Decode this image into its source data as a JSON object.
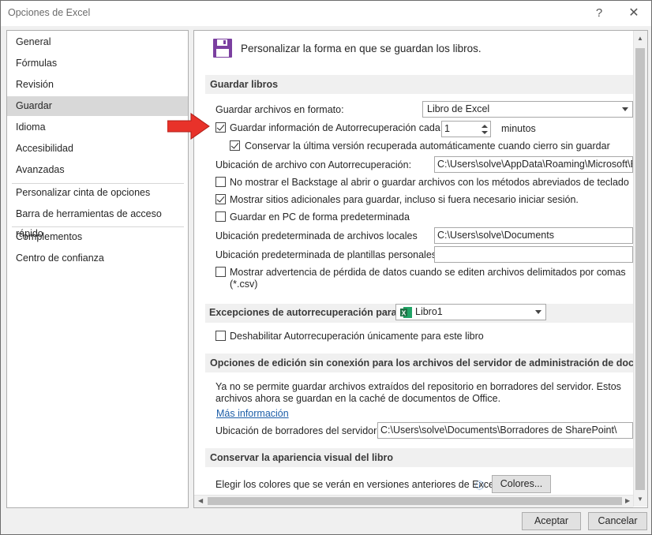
{
  "window": {
    "title": "Opciones de Excel",
    "help_glyph": "?",
    "close_glyph": "✕"
  },
  "sidebar": {
    "items": [
      {
        "label": "General"
      },
      {
        "label": "Fórmulas"
      },
      {
        "label": "Revisión"
      },
      {
        "label": "Guardar",
        "active": true
      },
      {
        "label": "Idioma"
      },
      {
        "label": "Accesibilidad"
      },
      {
        "label": "Avanzadas"
      },
      {
        "label": "Personalizar cinta de opciones"
      },
      {
        "label": "Barra de herramientas de acceso rápido"
      },
      {
        "label": "Complementos"
      },
      {
        "label": "Centro de confianza"
      }
    ]
  },
  "header": {
    "text": "Personalizar la forma en que se guardan los libros.",
    "icon": "save-icon"
  },
  "sections": {
    "guardar": "Guardar libros",
    "excepciones": "Excepciones de autorrecuperación para:",
    "offline": "Opciones de edición sin conexión para los archivos del servidor de administración de documentos",
    "visual": "Conservar la apariencia visual del libro"
  },
  "guardar": {
    "formato_label": "Guardar archivos en formato:",
    "formato_value": "Libro de Excel",
    "autorrec_label": "Guardar información de Autorrecuperación cada",
    "autorrec_checked": true,
    "autorrec_minutes": "1",
    "minutos": "minutos",
    "conservar_label": "Conservar la última versión recuperada automáticamente cuando cierro sin guardar",
    "conservar_checked": true,
    "ubicacion_label": "Ubicación de archivo con Autorrecuperación:",
    "ubicacion_value": "C:\\Users\\solve\\AppData\\Roaming\\Microsoft\\E",
    "backstage_label": "No mostrar el Backstage al abrir o guardar archivos con los métodos abreviados de teclado",
    "backstage_checked": false,
    "sitios_label": "Mostrar sitios adicionales para guardar, incluso si fuera necesario iniciar sesión.",
    "sitios_checked": true,
    "pc_label": "Guardar en PC de forma predeterminada",
    "pc_checked": false,
    "locales_label": "Ubicación predeterminada de archivos locales",
    "locales_value": "C:\\Users\\solve\\Documents",
    "plantillas_label": "Ubicación predeterminada de plantillas personales:",
    "plantillas_value": "",
    "advertencia_label_1": "Mostrar advertencia de pérdida de datos cuando se editen archivos delimitados por comas",
    "advertencia_label_2": "(*.csv)",
    "advertencia_checked": false
  },
  "excepciones": {
    "libro_value": "Libro1",
    "deshabilitar_label": "Deshabilitar Autorrecuperación únicamente para este libro",
    "deshabilitar_checked": false
  },
  "offline": {
    "desc_1": "Ya no se permite guardar archivos extraídos del repositorio en borradores del servidor. Estos",
    "desc_2": "archivos ahora se guardan en la caché de documentos de Office.",
    "link": "Más información",
    "borradores_label": "Ubicación de borradores del servidor:",
    "borradores_value": "C:\\Users\\solve\\Documents\\Borradores de SharePoint\\"
  },
  "visual": {
    "colores_label": "Elegir los colores que se verán en versiones anteriores de Excel.",
    "info_glyph": "ⓘ",
    "colores_button": "Colores..."
  },
  "footer": {
    "aceptar": "Aceptar",
    "cancelar": "Cancelar"
  },
  "colors": {
    "accent_purple": "#7b3fa0",
    "excel_green": "#1e7145",
    "arrow_red": "#e8322a",
    "link_blue": "#1d5ea8"
  }
}
